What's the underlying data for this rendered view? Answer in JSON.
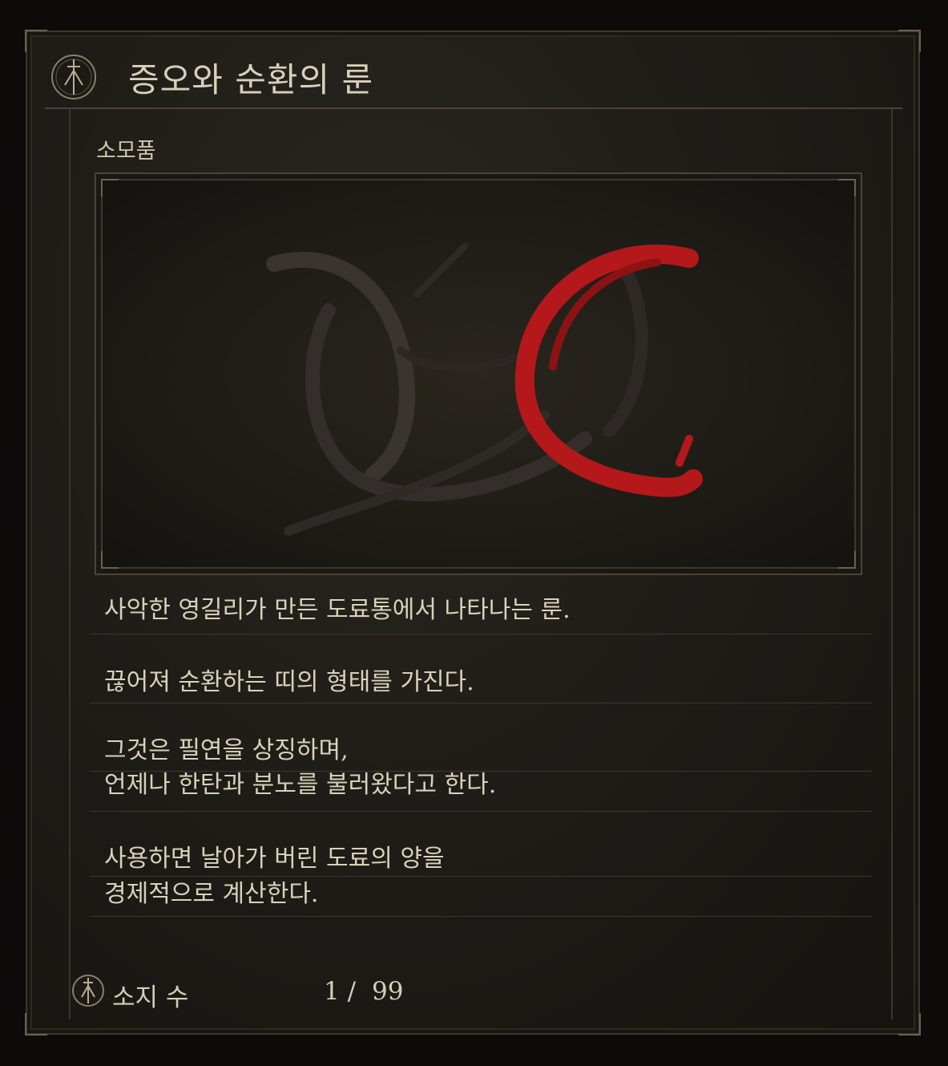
{
  "item": {
    "name": "증오와 순환의 룬",
    "category": "소모품",
    "icon": "rune-emblem-icon"
  },
  "description": {
    "p1_l1": "사악한 영길리가 만든 도료통에서 나타나는 룬.",
    "p2_l1": "끊어져 순환하는 띠의 형태를 가진다.",
    "p3_l1": "그것은 필연을 상징하며,",
    "p3_l2": "언제나 한탄과 분노를 불러왔다고 한다.",
    "p4_l1": "사용하면 날아가 버린 도료의 양을",
    "p4_l2": "경제적으로 계산한다."
  },
  "inventory": {
    "label": "소지 수",
    "count": "1 /",
    "max": "99"
  },
  "colors": {
    "panel_bg": "#1f1d18",
    "text": "#d9d1ba",
    "border": "#4a4436",
    "rune_dark": "#3a3431",
    "rune_red": "#b4181a"
  }
}
